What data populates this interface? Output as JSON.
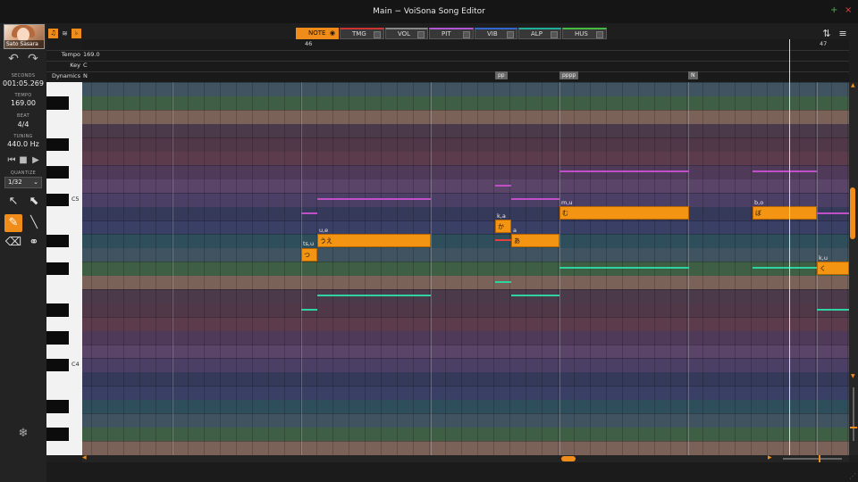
{
  "window": {
    "title": "Main − VoiSona Song Editor"
  },
  "singer": {
    "name": "Sato Sasara"
  },
  "transport": {
    "seconds_label": "SECONDS",
    "seconds": "001:05.269",
    "tempo_label": "TEMPO",
    "tempo": "169.00",
    "beat_label": "BEAT",
    "beat": "4/4",
    "tuning_label": "TUNING",
    "tuning": "440.0 Hz",
    "quantize_label": "QUANTIZE",
    "quantize": "1/32"
  },
  "modes": [
    {
      "label": "NOTE",
      "color": "#f08c1a"
    },
    {
      "label": "TMG",
      "color": "#cc3333"
    },
    {
      "label": "VOL",
      "color": "#888888"
    },
    {
      "label": "PIT",
      "color": "#b055d6"
    },
    {
      "label": "VIB",
      "color": "#3366cc"
    },
    {
      "label": "ALP",
      "color": "#1fae9a"
    },
    {
      "label": "HUS",
      "color": "#44bb44"
    }
  ],
  "timeline": {
    "measure_a": "46",
    "measure_b": "47"
  },
  "lanes": {
    "tempo_label": "Tempo",
    "tempo_value": "169.0",
    "key_label": "Key",
    "key_value": "C",
    "dynamics_label": "Dynamics",
    "dynamics_value": "N",
    "dynamics_marks": [
      "pp",
      "pppp",
      "N"
    ]
  },
  "keyboard": {
    "c5": "C5",
    "c4": "C4"
  },
  "notes": [
    {
      "phoneme": "ts,u",
      "lyric": "つ"
    },
    {
      "phoneme": "u,e",
      "lyric": "うえ"
    },
    {
      "phoneme": "k,a",
      "lyric": "か"
    },
    {
      "phoneme": "a",
      "lyric": "あ"
    },
    {
      "phoneme": "m,u",
      "lyric": "む"
    },
    {
      "phoneme": "b,o",
      "lyric": "ぼ"
    },
    {
      "phoneme": "k,u",
      "lyric": "く"
    }
  ],
  "icons": {
    "undo": "undo-icon",
    "redo": "redo-icon",
    "select": "arrow-cursor-icon",
    "range": "range-select-icon",
    "pencil": "pencil-icon",
    "line": "line-icon",
    "eraser": "eraser-icon",
    "link": "link-icon",
    "snowflake": "snowflake-icon"
  },
  "colors": {
    "accent": "#f08c1a",
    "note_fill": "#f39413",
    "pitch_line": "#c050c8",
    "alpha_line": "#2ed3a0"
  }
}
